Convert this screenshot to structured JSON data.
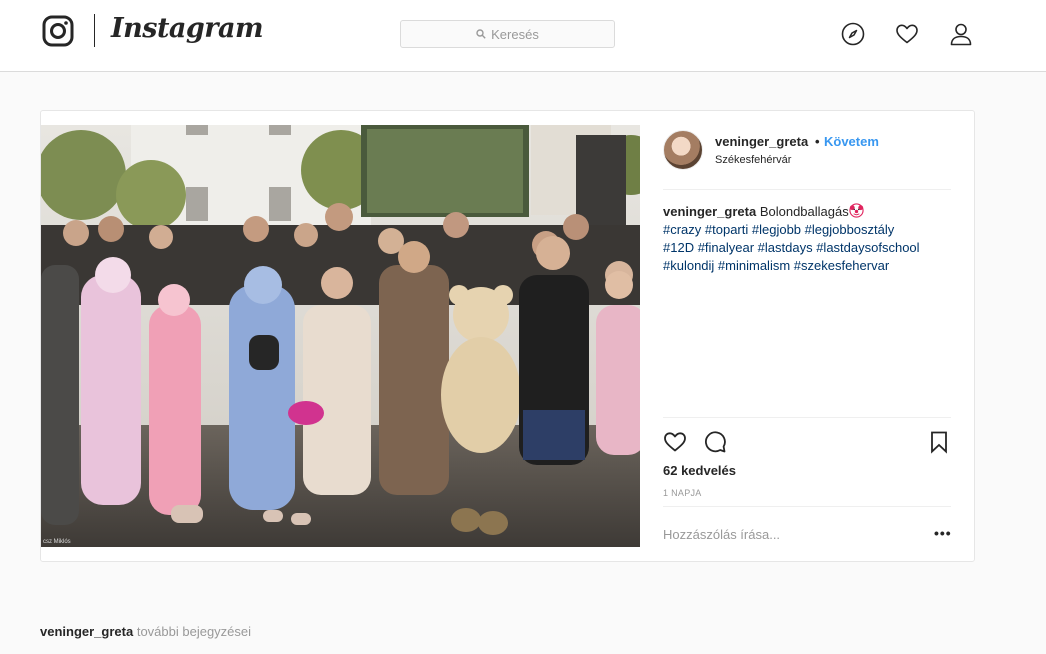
{
  "header": {
    "wordmark": "Instagram",
    "search_placeholder": "Keresés",
    "icons": [
      "instagram-logo-icon",
      "search-icon",
      "compass-icon",
      "heart-icon",
      "user-icon"
    ]
  },
  "post": {
    "username": "veninger_greta",
    "separator": "•",
    "follow_label": "Követem",
    "location": "Székesfehérvár",
    "photo_credit": "csz Miklós",
    "caption": {
      "username": "veninger_greta",
      "text": "Bolondballagás",
      "emoji": "clown-face-icon",
      "hashtags_line1": "#crazy #toparti #legjobb #legjobbosztály",
      "hashtags_line2": "#12D #finalyear #lastdays #lastdaysofschool",
      "hashtags_line3": "#kulondij #minimalism #szekesfehervar"
    },
    "likes": "62 kedvelés",
    "time_ago": "1 NAPJA",
    "comment_placeholder": "Hozzászólás írása...",
    "more_options": "•••"
  },
  "footer": {
    "username": "veninger_greta",
    "more_posts": "további bejegyzései"
  },
  "colors": {
    "link_blue": "#3897f0",
    "hashtag": "#003569",
    "border": "#dbdbdb",
    "page_bg": "#fafafa"
  }
}
